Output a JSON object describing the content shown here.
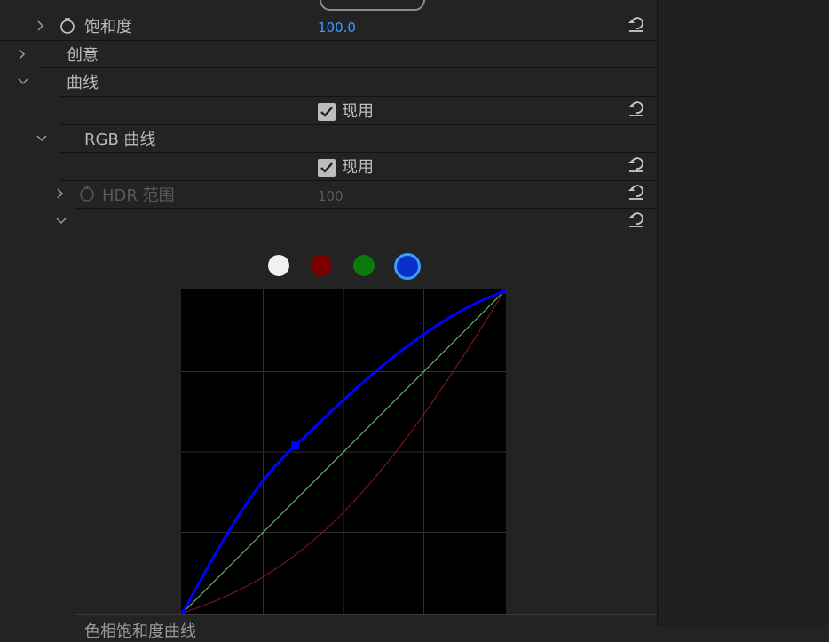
{
  "rows": {
    "saturation": {
      "label": "饱和度",
      "value": "100.0"
    },
    "creative": {
      "label": "创意"
    },
    "curves": {
      "label": "曲线"
    },
    "curves_enable": {
      "label": "现用"
    },
    "rgb_curves": {
      "label": "RGB 曲线"
    },
    "rgb_enable": {
      "label": "现用"
    },
    "hdr_range": {
      "label": "HDR 范围",
      "value": "100"
    }
  },
  "channels": [
    {
      "name": "white-channel",
      "color": "#f0f0f0"
    },
    {
      "name": "red-channel",
      "color": "#7a0000"
    },
    {
      "name": "green-channel",
      "color": "#0a7a0a"
    },
    {
      "name": "blue-channel",
      "color": "#0a2fc8",
      "selected": true
    }
  ],
  "colors": {
    "accent_blue": "#3b9cff",
    "curve_blue": "#0000ff",
    "curve_red": "#8b1a1a",
    "curve_diag": "#6fcf6f"
  },
  "chart_data": {
    "type": "line",
    "xlim": [
      0,
      1
    ],
    "ylim": [
      0,
      1
    ],
    "grid": true,
    "series": [
      {
        "points": [
          [
            0,
            0
          ],
          [
            1,
            1
          ]
        ]
      },
      {
        "points": [
          [
            0,
            0
          ],
          [
            0.35,
            0.52
          ],
          [
            1,
            1
          ]
        ]
      },
      {
        "points": [
          [
            0,
            0
          ],
          [
            0.5,
            0.26
          ],
          [
            1,
            1
          ]
        ]
      }
    ]
  },
  "footer": {
    "partial_text": "色相饱和度曲线"
  }
}
